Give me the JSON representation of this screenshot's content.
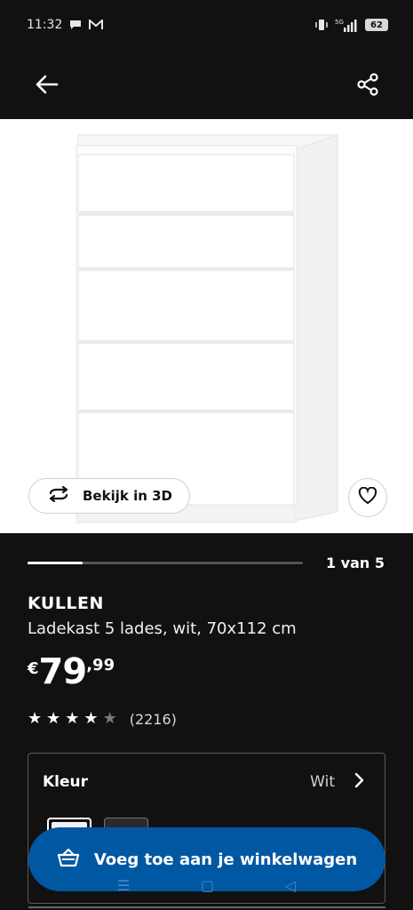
{
  "status_bar": {
    "time": "11:32",
    "network": "5G",
    "battery": "62"
  },
  "app_bar": {
    "back_icon": "arrow-left-icon",
    "share_icon": "share-icon"
  },
  "hero": {
    "view_3d_label": "Bekijk in 3D",
    "view_3d_icon": "rotate-3d-icon",
    "favorite_icon": "heart-icon"
  },
  "gallery": {
    "current": 1,
    "total": 5,
    "position_label": "1 van 5",
    "progress_fraction": 0.2
  },
  "product": {
    "name": "KULLEN",
    "description": "Ladekast 5 lades, wit, 70x112 cm",
    "price_currency": "€",
    "price_int": "79",
    "price_dec": ",99",
    "rating_value": 4,
    "rating_max": 5,
    "rating_count": "(2216)"
  },
  "color_selector": {
    "label": "Kleur",
    "value": "Wit",
    "swatches": [
      "white",
      "black-brown"
    ]
  },
  "cart": {
    "label": "Voeg toe aan je winkelwagen",
    "icon": "basket-icon"
  },
  "nav_hints": [
    "menu-icon",
    "home-square-icon",
    "back-triangle-icon"
  ],
  "colors": {
    "background": "#111111",
    "accent_blue": "#0058a3",
    "white": "#ffffff"
  }
}
